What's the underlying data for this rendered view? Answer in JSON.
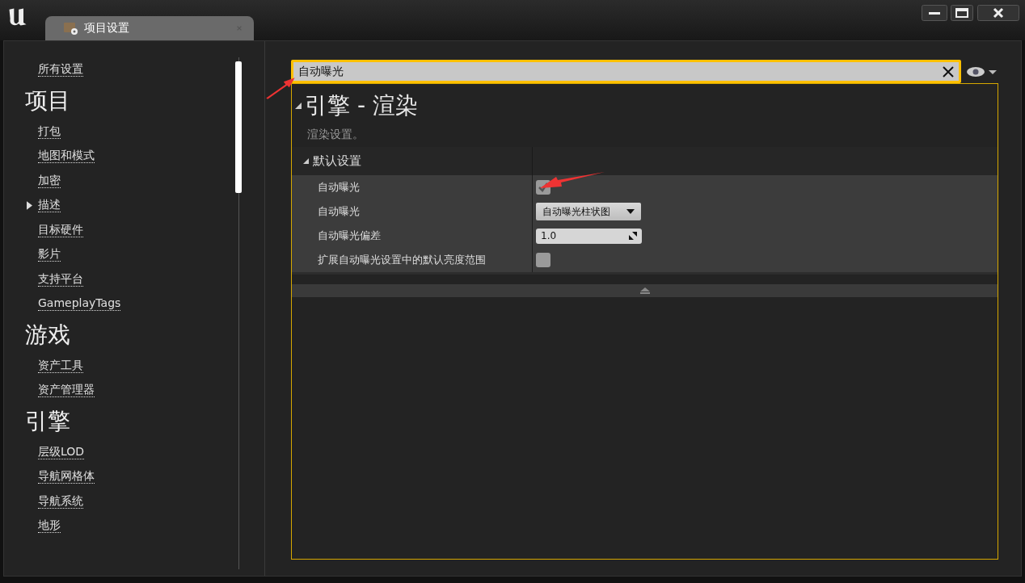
{
  "window": {
    "tab": {
      "title": "项目设置"
    }
  },
  "sidebar": {
    "top_item": {
      "label": "所有设置"
    },
    "sections": [
      {
        "title": "项目",
        "items": [
          {
            "label": "打包",
            "selected": false
          },
          {
            "label": "地图和模式",
            "selected": false
          },
          {
            "label": "加密",
            "selected": false
          },
          {
            "label": "描述",
            "selected": true
          },
          {
            "label": "目标硬件",
            "selected": false
          },
          {
            "label": "影片",
            "selected": false
          },
          {
            "label": "支持平台",
            "selected": false
          },
          {
            "label": "GameplayTags",
            "selected": false
          }
        ]
      },
      {
        "title": "游戏",
        "items": [
          {
            "label": "资产工具",
            "selected": false
          },
          {
            "label": "资产管理器",
            "selected": false
          }
        ]
      },
      {
        "title": "引擎",
        "items": [
          {
            "label": "层级LOD",
            "selected": false
          },
          {
            "label": "导航网格体",
            "selected": false
          },
          {
            "label": "导航系统",
            "selected": false
          },
          {
            "label": "地形",
            "selected": false
          }
        ]
      }
    ]
  },
  "search": {
    "value": "自动曝光"
  },
  "category": {
    "title": "引擎 - 渲染",
    "expanded": true,
    "description": "渲染设置。",
    "group": {
      "title": "默认设置",
      "expanded": true,
      "rows": [
        {
          "label": "自动曝光",
          "kind": "checkbox",
          "checked": true
        },
        {
          "label": "自动曝光",
          "kind": "dropdown",
          "value": "自动曝光柱状图"
        },
        {
          "label": "自动曝光偏差",
          "kind": "number",
          "value": "1.0"
        },
        {
          "label": "扩展自动曝光设置中的默认亮度范围",
          "kind": "checkbox",
          "checked": false
        }
      ]
    }
  }
}
